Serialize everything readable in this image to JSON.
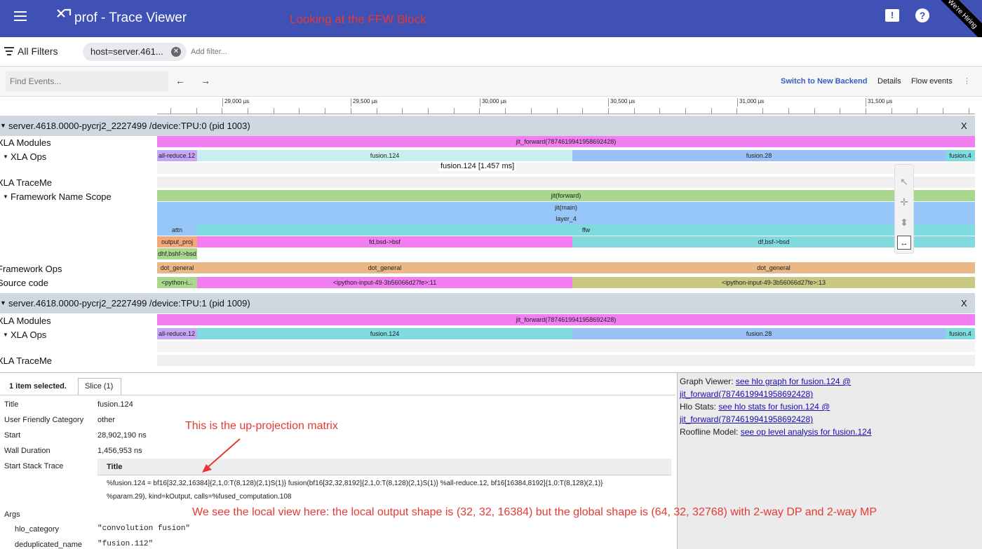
{
  "app": {
    "title": "prof - Trace Viewer",
    "annotation_top": "Looking at the FFW Block",
    "hiring_ribbon": "We're Hiring",
    "menu_icon": "hamburger-icon",
    "feedback_icon": "feedback-icon",
    "help_icon": "help-icon"
  },
  "filters": {
    "all_filters_label": "All Filters",
    "chip_label": "host=server.461...",
    "add_filter_placeholder": "Add filter..."
  },
  "search": {
    "placeholder": "Find Events...",
    "prev_label": "←",
    "next_label": "→",
    "switch_backend_label": "Switch to New Backend",
    "details_label": "Details",
    "flow_events_label": "Flow events",
    "more_label": "⋮"
  },
  "ruler": {
    "labels": [
      "29,000 µs",
      "29,500 µs",
      "30,000 µs",
      "30,500 µs",
      "31,000 µs",
      "31,500 µs"
    ]
  },
  "devices": [
    {
      "title": "server.4618.0000-pycrj2_2227499 /device:TPU:0 (pid 1003)",
      "close_label": "X",
      "rows": {
        "xla_modules": "XLA Modules",
        "xla_ops": "XLA Ops",
        "xla_traceme": "XLA TraceMe",
        "framework_name_scope": "Framework Name Scope",
        "framework_ops": "Framework Ops",
        "source_code": "Source code"
      },
      "module_bar": "jit_forward(7874619941958692428)",
      "ops": [
        "all-reduce.12",
        "fusion.124",
        "fusion.28",
        "fusion.4"
      ],
      "tooltip": "fusion.124 [1.457 ms]",
      "scope": {
        "l1": "jit(forward)",
        "l2": "jit(main)",
        "l3": "layer_4",
        "attn": "attn",
        "ffw": "ffw",
        "output_proj": "output_proj",
        "fd_bsd": "fd,bsd->bsf",
        "df_bsf": "df,bsf->bsd",
        "dhf": "dhf,bshf->bsd"
      },
      "fw_ops": [
        "dot_general",
        "dot_general",
        "dot_general"
      ],
      "source": [
        "<python-i...",
        "<ipython-input-49-3b56066d27fe>:11",
        "<ipython-input-49-3b56066d27fe>:13"
      ]
    },
    {
      "title": "server.4618.0000-pycrj2_2227499 /device:TPU:1 (pid 1009)",
      "close_label": "X",
      "rows": {
        "xla_modules": "XLA Modules",
        "xla_ops": "XLA Ops",
        "xla_traceme": "XLA TraceMe"
      },
      "module_bar": "jit_forward(7874619941958692428)",
      "ops": [
        "all-reduce.12",
        "fusion.124",
        "fusion.28",
        "fusion.4"
      ]
    }
  ],
  "details": {
    "selected_label": "1 item selected.",
    "tab_label": "Slice (1)",
    "title_key": "Title",
    "title_val": "fusion.124",
    "category_key": "User Friendly Category",
    "category_val": "other",
    "start_key": "Start",
    "start_val": "28,902,190 ns",
    "wall_key": "Wall Duration",
    "wall_val": "1,456,953 ns",
    "stack_key": "Start Stack Trace",
    "stack_header": "Title",
    "stack_line1": "%fusion.124 = bf16[32,32,16384]{2,1,0:T(8,128)(2,1)S(1)} fusion(bf16[32,32,8192]{2,1,0:T(8,128)(2,1)S(1)} %all-reduce.12, bf16[16384,8192]{1,0:T(8,128)(2,1)}",
    "stack_line2": "%param.29), kind=kOutput, calls=%fused_computation.108",
    "args_key": "Args",
    "hlo_category_key": "hlo_category",
    "hlo_category_val": "\"convolution fusion\"",
    "dedup_key": "deduplicated_name",
    "dedup_val": "\"fusion.112\"",
    "annotation_upproj": "This is the up-projection matrix",
    "annotation_shape": "We see the local view here: the local output shape is (32, 32, 16384) but the global shape is (64, 32, 32768) with 2-way DP and 2-way MP"
  },
  "side": {
    "graph_viewer_label": "Graph Viewer: ",
    "graph_viewer_link": "see hlo graph for fusion.124 @",
    "graph_viewer_link2": "jit_forward(7874619941958692428)",
    "hlo_stats_label": "Hlo Stats: ",
    "hlo_stats_link": "see hlo stats for fusion.124 @",
    "hlo_stats_link2": "jit_forward(7874619941958692428)",
    "roofline_label": "Roofline Model: ",
    "roofline_link": "see op level analysis for fusion.124"
  },
  "colors": {
    "topbar": "#3f51b5",
    "magenta": "#f27ef2",
    "cyan": "#7fdbdf",
    "blue": "#9bc0f5",
    "green": "#a7d88e",
    "lightblue": "#97c7f9",
    "orange": "#e9b886",
    "olive": "#c9c985",
    "purple": "#c7a6f7"
  }
}
